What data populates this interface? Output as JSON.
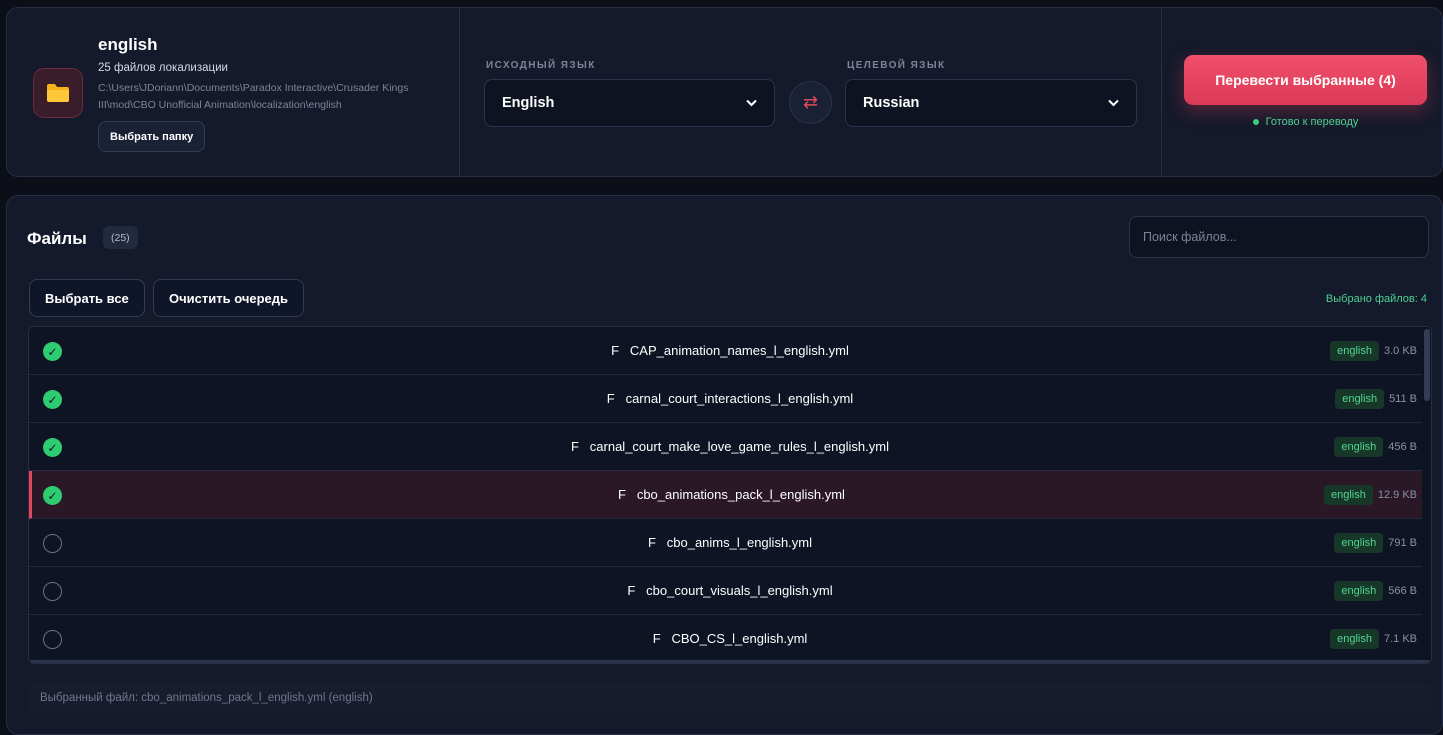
{
  "folder": {
    "name": "english",
    "count_text": "25 файлов локализации",
    "path": "C:\\Users\\JDoriann\\Documents\\Paradox Interactive\\Crusader Kings III\\mod\\CBO Unofficial Animation\\localization\\english",
    "choose_label": "Выбрать папку",
    "icon": "folder-icon"
  },
  "languages": {
    "source_label": "ИСХОДНЫЙ ЯЗЫК",
    "source_value": "English",
    "target_label": "ЦЕЛЕВОЙ ЯЗЫК",
    "target_value": "Russian",
    "swap_icon": "⇄"
  },
  "action": {
    "translate_label": "Перевести выбранные (4)",
    "status_text": "Готово к переводу"
  },
  "files_panel": {
    "title": "Файлы",
    "count": "(25)",
    "search_placeholder": "Поиск файлов...",
    "select_all_label": "Выбрать все",
    "clear_queue_label": "Очистить очередь",
    "selected_count_text": "Выбрано файлов: 4",
    "footer_text": "Выбранный файл: cbo_animations_pack_l_english.yml (english)"
  },
  "files": [
    {
      "name": "F   CAP_animation_names_l_english.yml",
      "lang": "english",
      "size": "3.0 KB",
      "checked": true,
      "active": false
    },
    {
      "name": "F   carnal_court_interactions_l_english.yml",
      "lang": "english",
      "size": "511 B",
      "checked": true,
      "active": false
    },
    {
      "name": "F   carnal_court_make_love_game_rules_l_english.yml",
      "lang": "english",
      "size": "456 B",
      "checked": true,
      "active": false
    },
    {
      "name": "F   cbo_animations_pack_l_english.yml",
      "lang": "english",
      "size": "12.9 KB",
      "checked": true,
      "active": true
    },
    {
      "name": "F   cbo_anims_l_english.yml",
      "lang": "english",
      "size": "791 B",
      "checked": false,
      "active": false
    },
    {
      "name": "F   cbo_court_visuals_l_english.yml",
      "lang": "english",
      "size": "566 B",
      "checked": false,
      "active": false
    },
    {
      "name": "F   CBO_CS_l_english.yml",
      "lang": "english",
      "size": "7.1 KB",
      "checked": false,
      "active": false
    }
  ],
  "colors": {
    "accent": "#e0485f",
    "success": "#2ecc71",
    "panel": "#141a2b",
    "background": "#0c0f18"
  }
}
